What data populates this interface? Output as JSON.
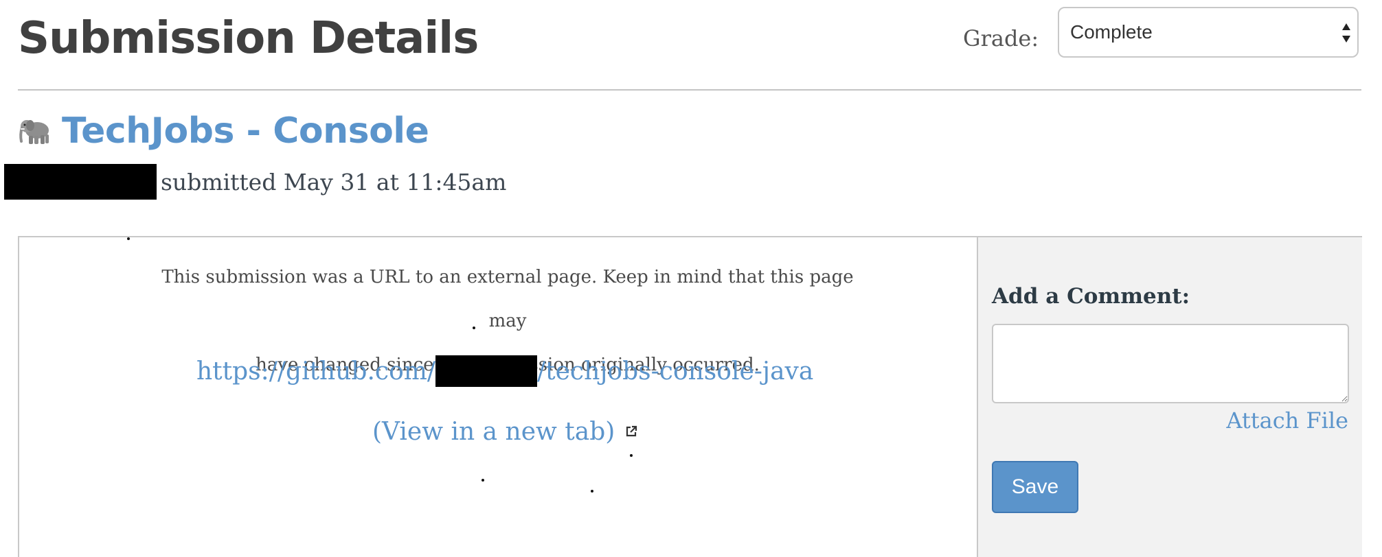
{
  "header": {
    "title": "Submission Details",
    "grade_label": "Grade:",
    "grade_value": "Complete"
  },
  "assignment": {
    "title": "TechJobs - Console",
    "icon": "elephant-icon",
    "submitted_text": "submitted May 31 at 11:45am"
  },
  "submission": {
    "notice_line1": "This submission was a URL to an external page. Keep in mind that this page may",
    "notice_line2": "have changed since the submission originally occurred.",
    "url_prefix": "https://github.com/",
    "url_suffix": "/techjobs-console-java",
    "view_new_tab": "(View in a new tab)"
  },
  "comment": {
    "label": "Add a Comment:",
    "value": "",
    "attach_label": "Attach File",
    "save_label": "Save"
  },
  "colors": {
    "link": "#5b94cb",
    "button": "#5b94cb",
    "panel_bg": "#f2f2f2"
  }
}
